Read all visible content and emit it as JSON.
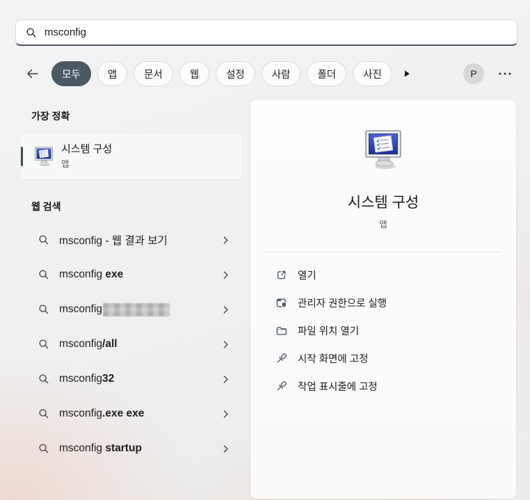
{
  "search": {
    "value": "msconfig"
  },
  "toolbar": {
    "tabs": [
      {
        "label": "모두",
        "selected": true
      },
      {
        "label": "앱",
        "selected": false
      },
      {
        "label": "문서",
        "selected": false
      },
      {
        "label": "웹",
        "selected": false
      },
      {
        "label": "설정",
        "selected": false
      },
      {
        "label": "사람",
        "selected": false
      },
      {
        "label": "폴더",
        "selected": false
      },
      {
        "label": "사진",
        "selected": false
      }
    ],
    "avatar_initial": "P"
  },
  "results": {
    "best_match_header": "가장 정확",
    "best_match": {
      "title": "시스템 구성",
      "subtitle": "앱"
    },
    "web_search_header": "웹 검색",
    "web_items": [
      {
        "text": "msconfig - 웹 결과 보기",
        "bold": "",
        "redacted": false
      },
      {
        "text": "msconfig ",
        "bold": "exe",
        "redacted": false
      },
      {
        "text": "msconfig",
        "bold": "",
        "redacted": true
      },
      {
        "text": "msconfig",
        "bold": "/all",
        "redacted": false
      },
      {
        "text": "msconfig",
        "bold": "32",
        "redacted": false
      },
      {
        "text": "msconfig",
        "bold": ".exe exe",
        "redacted": false
      },
      {
        "text": "msconfig ",
        "bold": "startup",
        "redacted": false
      }
    ]
  },
  "preview": {
    "title": "시스템 구성",
    "subtitle": "앱",
    "actions": [
      {
        "icon": "open-icon",
        "label": "열기"
      },
      {
        "icon": "admin-shield-icon",
        "label": "관리자 권한으로 실행"
      },
      {
        "icon": "folder-icon",
        "label": "파일 위치 열기"
      },
      {
        "icon": "pin-icon",
        "label": "시작 화면에 고정"
      },
      {
        "icon": "pin-icon",
        "label": "작업 표시줄에 고정"
      }
    ]
  },
  "colors": {
    "selected_pill": "#4b5963",
    "accent_bar": "#3f4b54",
    "search_underline": "#4c565e",
    "screen_blue": "#2a46c0"
  }
}
